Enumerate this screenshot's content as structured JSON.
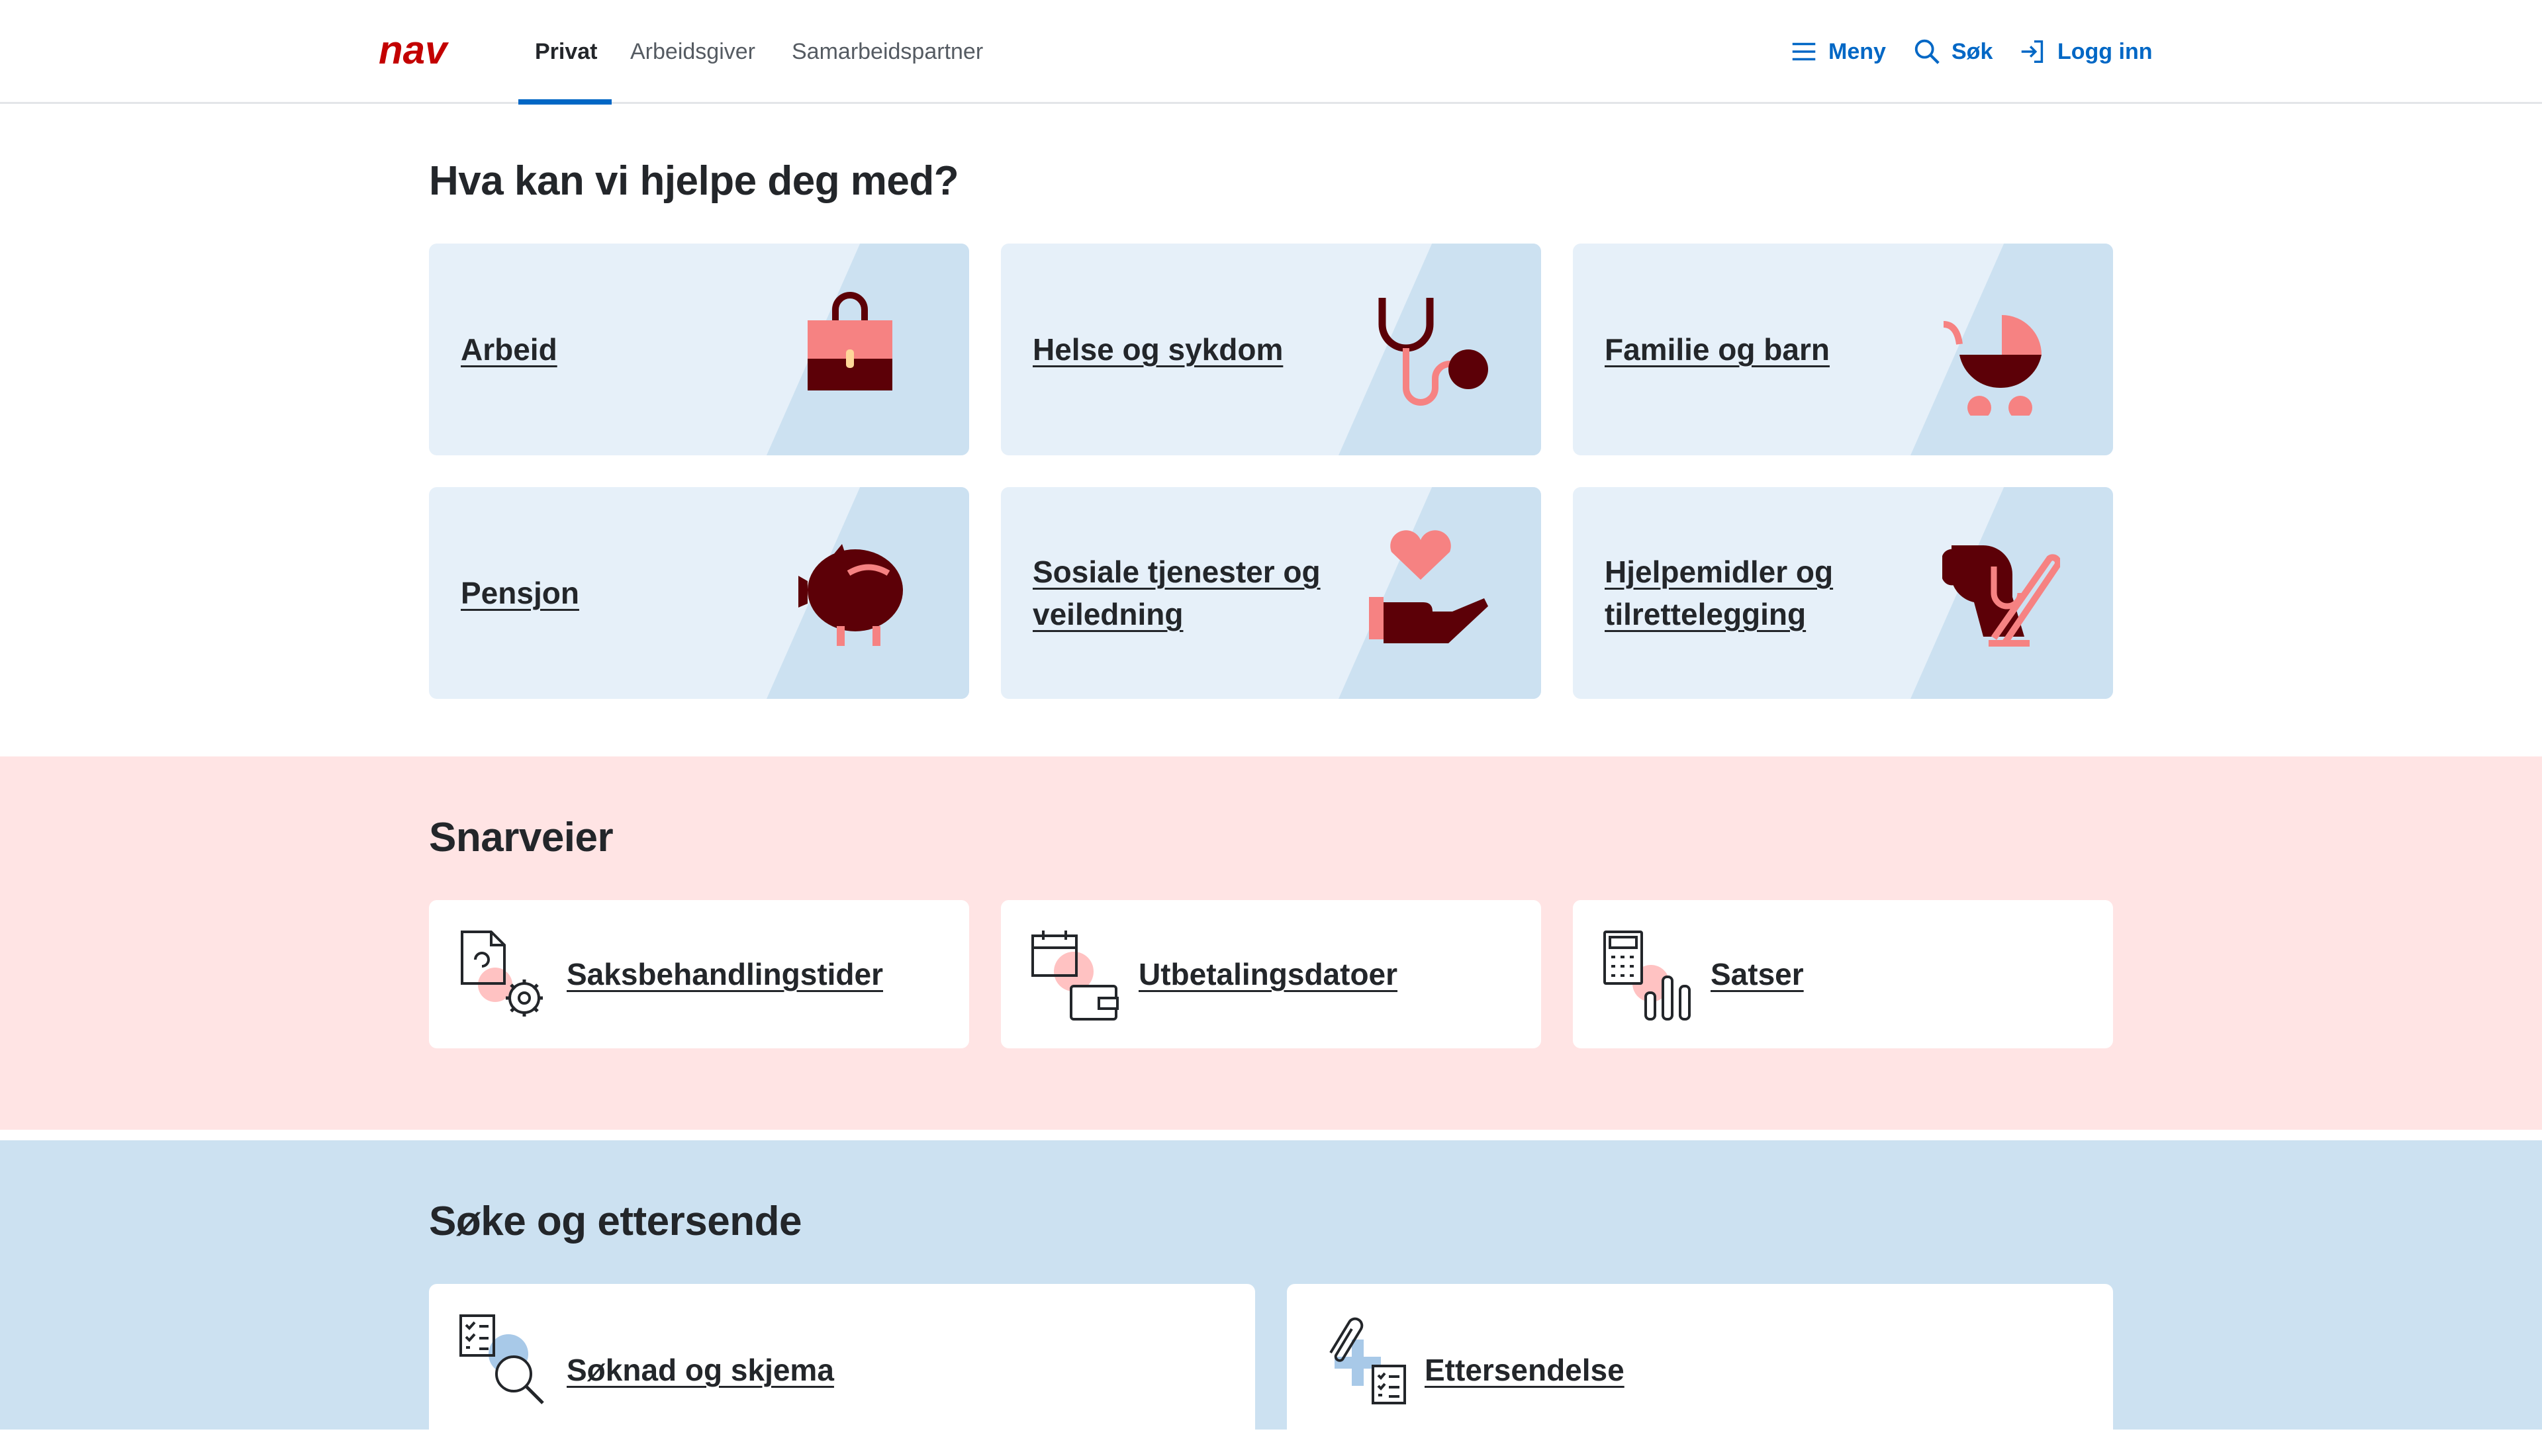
{
  "header": {
    "logo": "nav",
    "tabs": [
      {
        "label": "Privat",
        "active": true
      },
      {
        "label": "Arbeidsgiver",
        "active": false
      },
      {
        "label": "Samarbeidspartner",
        "active": false
      }
    ],
    "menu_label": "Meny",
    "search_label": "Søk",
    "login_label": "Logg inn"
  },
  "help": {
    "heading": "Hva kan vi hjelpe deg med?",
    "cards": [
      {
        "label": "Arbeid",
        "icon": "briefcase-icon"
      },
      {
        "label": "Helse og sykdom",
        "icon": "stethoscope-icon"
      },
      {
        "label": "Familie og barn",
        "icon": "stroller-icon"
      },
      {
        "label": "Pensjon",
        "icon": "piggy-bank-icon"
      },
      {
        "label": "Sosiale tjenester og veiledning",
        "icon": "hand-heart-icon"
      },
      {
        "label": "Hjelpemidler og tilrettelegging",
        "icon": "guide-dog-icon"
      }
    ]
  },
  "shortcuts": {
    "heading": "Snarveier",
    "items": [
      {
        "label": "Saksbehandlingstider",
        "icon": "document-gear-icon"
      },
      {
        "label": "Utbetalingsdatoer",
        "icon": "calendar-wallet-icon"
      },
      {
        "label": "Satser",
        "icon": "calculator-chart-icon"
      }
    ]
  },
  "apply": {
    "heading": "Søke og ettersende",
    "items": [
      {
        "label": "Søknad og skjema",
        "icon": "form-search-icon"
      },
      {
        "label": "Ettersendelse",
        "icon": "paperclip-form-icon"
      }
    ]
  },
  "colors": {
    "accent": "#0067c5",
    "brand_red": "#c30000",
    "card_bg": "#e6f0f9",
    "card_diag": "#cce1f1",
    "pink_band": "#ffe4e4",
    "blue_band": "#cce1f1",
    "icon_dark": "#5c0007",
    "icon_pink": "#f68282"
  }
}
